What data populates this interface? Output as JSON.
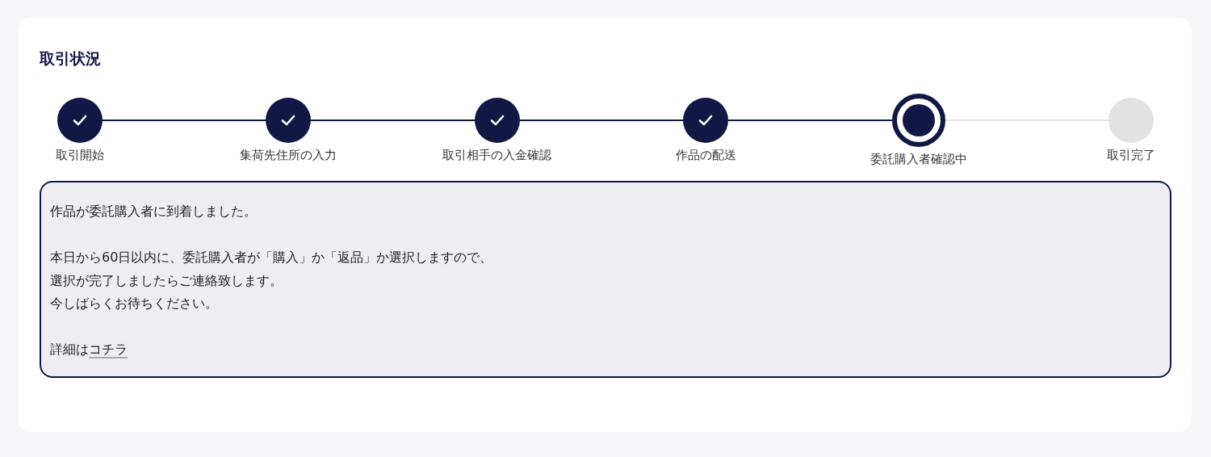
{
  "title": "取引状況",
  "steps": [
    {
      "label": "取引開始",
      "completed": true,
      "selected": false
    },
    {
      "label": "集荷先住所の入力",
      "completed": true,
      "selected": false
    },
    {
      "label": "取引相手の入金確認",
      "completed": true,
      "selected": false
    },
    {
      "label": "作品の配送",
      "completed": true,
      "selected": false
    },
    {
      "label": "委託購入者確認中",
      "completed": false,
      "selected": true
    },
    {
      "label": "取引完了",
      "completed": false,
      "selected": false
    }
  ],
  "message": {
    "paragraphs": [
      [
        "作品が委託購入者に到着しました。"
      ],
      [
        "本日から60日以内に、委託購入者が「購入」か「返品」か選択しますので、",
        "選択が完了しましたらご連絡致します。",
        "今しばらくお待ちください。"
      ]
    ],
    "detail_text": "詳細は",
    "detail_link": "コチラ"
  }
}
